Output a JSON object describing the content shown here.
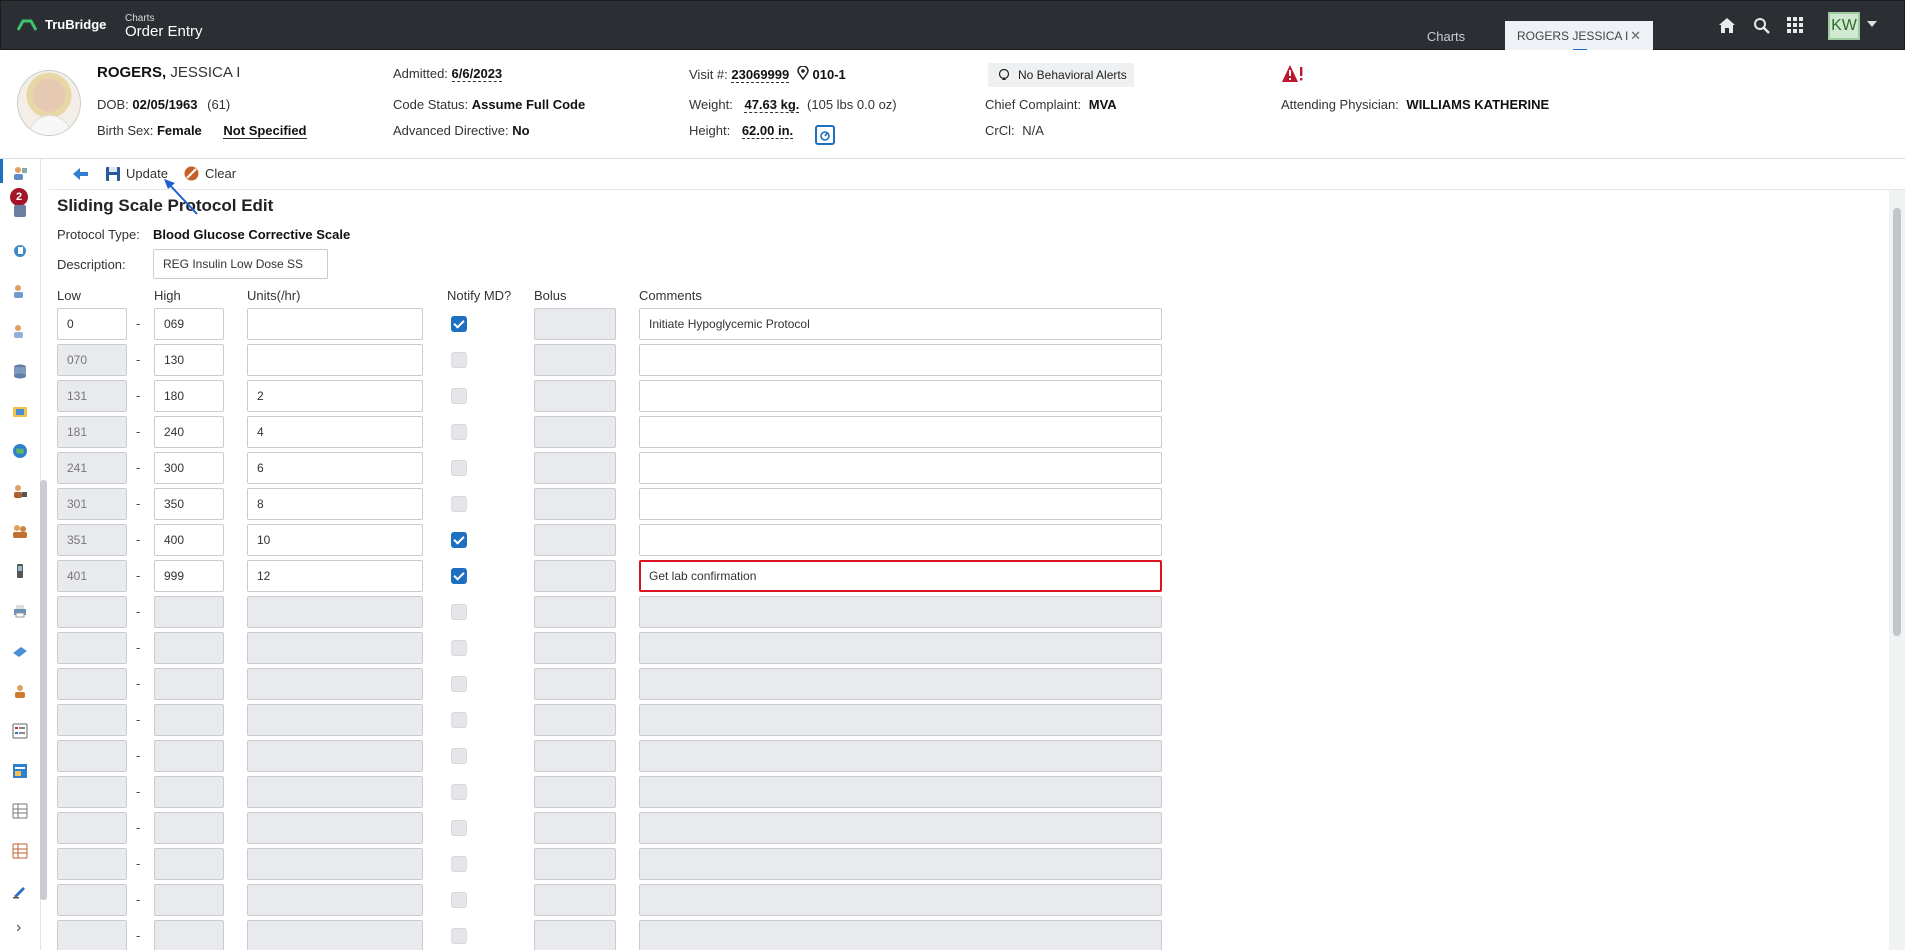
{
  "topbar": {
    "brand": "TruBridge",
    "app_sup": "Charts",
    "app_title": "Order Entry",
    "tabs": [
      {
        "label": "Charts"
      },
      {
        "label": "ROGERS JESSICA I"
      }
    ],
    "user_initials": "KW"
  },
  "patient": {
    "last_name": "ROGERS,",
    "first_name": "JESSICA I",
    "dob_label": "DOB:",
    "dob": "02/05/1963",
    "age": "(61)",
    "sex_label": "Birth Sex:",
    "sex": "Female",
    "gender": "Not Specified",
    "admitted_label": "Admitted:",
    "admitted": "6/6/2023",
    "code_label": "Code Status:",
    "code": "Assume Full Code",
    "adv_label": "Advanced Directive:",
    "adv": "No",
    "visit_label": "Visit #:",
    "visit": "23069999",
    "room": "010-1",
    "weight_label": "Weight:",
    "weight": "47.63 kg.",
    "weight_alt": "(105 lbs 0.0 oz)",
    "height_label": "Height:",
    "height": "62.00 in.",
    "behavioral": "No Behavioral Alerts",
    "complaint_label": "Chief Complaint:",
    "complaint": "MVA",
    "crcl_label": "CrCl:",
    "crcl": "N/A",
    "physician_label": "Attending Physician:",
    "physician": "WILLIAMS KATHERINE"
  },
  "sidebar": {
    "badge_count": "2"
  },
  "toolbar": {
    "update_label": "Update",
    "clear_label": "Clear"
  },
  "form": {
    "title": "Sliding Scale Protocol Edit",
    "protocol_type_label": "Protocol Type:",
    "protocol_type": "Blood Glucose Corrective Scale",
    "description_label": "Description:",
    "description": "REG Insulin Low Dose SS",
    "columns": {
      "low": "Low",
      "high": "High",
      "units": "Units(/hr)",
      "notify": "Notify MD?",
      "bolus": "Bolus",
      "comments": "Comments"
    },
    "range_separator": "-",
    "rows": [
      {
        "low": "0",
        "high": "069",
        "units": "",
        "notify": true,
        "comment": "Initiate Hypoglycemic Protocol"
      },
      {
        "low": "070",
        "high": "130",
        "units": "",
        "notify": false,
        "comment": ""
      },
      {
        "low": "131",
        "high": "180",
        "units": "2",
        "notify": false,
        "comment": ""
      },
      {
        "low": "181",
        "high": "240",
        "units": "4",
        "notify": false,
        "comment": ""
      },
      {
        "low": "241",
        "high": "300",
        "units": "6",
        "notify": false,
        "comment": ""
      },
      {
        "low": "301",
        "high": "350",
        "units": "8",
        "notify": false,
        "comment": ""
      },
      {
        "low": "351",
        "high": "400",
        "units": "10",
        "notify": true,
        "comment": ""
      },
      {
        "low": "401",
        "high": "999",
        "units": "12",
        "notify": true,
        "comment": "Get lab confirmation"
      },
      {
        "low": "",
        "high": "",
        "units": "",
        "notify": false,
        "comment": ""
      },
      {
        "low": "",
        "high": "",
        "units": "",
        "notify": false,
        "comment": ""
      },
      {
        "low": "",
        "high": "",
        "units": "",
        "notify": false,
        "comment": ""
      },
      {
        "low": "",
        "high": "",
        "units": "",
        "notify": false,
        "comment": ""
      },
      {
        "low": "",
        "high": "",
        "units": "",
        "notify": false,
        "comment": ""
      },
      {
        "low": "",
        "high": "",
        "units": "",
        "notify": false,
        "comment": ""
      },
      {
        "low": "",
        "high": "",
        "units": "",
        "notify": false,
        "comment": ""
      },
      {
        "low": "",
        "high": "",
        "units": "",
        "notify": false,
        "comment": ""
      },
      {
        "low": "",
        "high": "",
        "units": "",
        "notify": false,
        "comment": ""
      },
      {
        "low": "",
        "high": "",
        "units": "",
        "notify": false,
        "comment": ""
      },
      {
        "low": "",
        "high": "",
        "units": "",
        "notify": false,
        "comment": ""
      }
    ]
  },
  "colors": {
    "accent": "#1d6fbf",
    "focus_border": "#d9141e",
    "topbar": "#2b2f33"
  }
}
